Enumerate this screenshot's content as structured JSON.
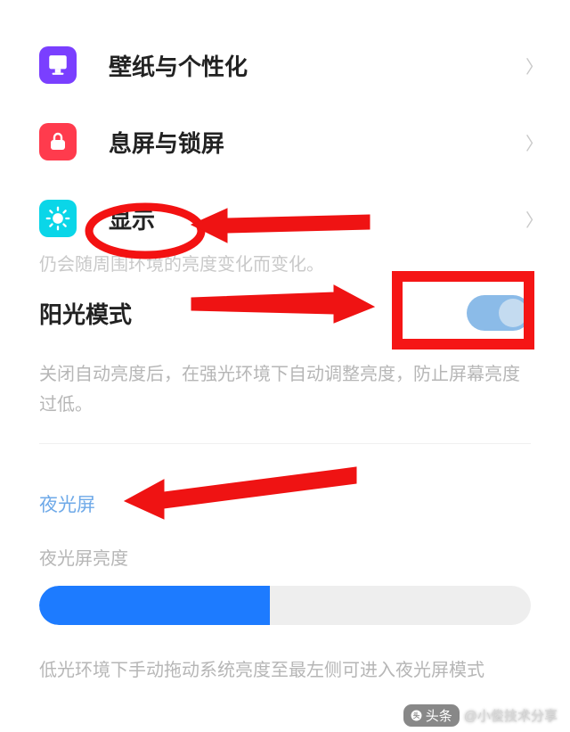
{
  "settings": {
    "items": [
      {
        "label": "壁纸与个性化",
        "icon": "wallpaper"
      },
      {
        "label": "息屏与锁屏",
        "icon": "lockscreen"
      },
      {
        "label": "显示",
        "icon": "display"
      }
    ]
  },
  "truncated_hint": "仍会随周围环境的亮度变化而变化。",
  "sunlight_mode": {
    "label": "阳光模式",
    "enabled": true,
    "description": "关闭自动亮度后，在强光环境下自动调整亮度，防止屏幕亮度过低。"
  },
  "night_light": {
    "section_title": "夜光屏",
    "brightness_label": "夜光屏亮度",
    "slider_value_pct": 47,
    "description": "低光环境下手动拖动系统亮度至最左侧可进入夜光屏模式"
  },
  "watermark": {
    "chip": "头条",
    "author": "@小俊技术分享"
  }
}
